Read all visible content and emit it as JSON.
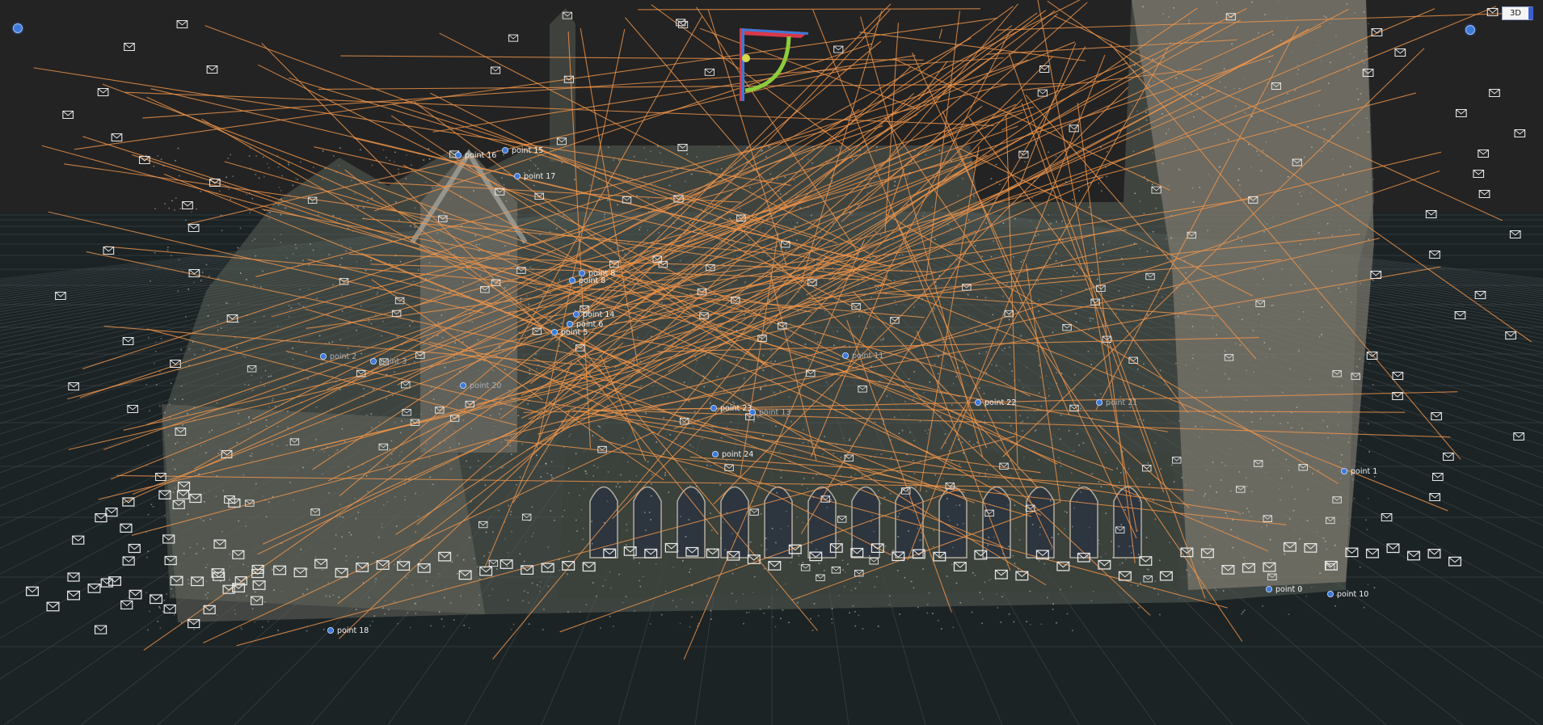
{
  "viewport": {
    "view_mode_label": "3D",
    "background_color": "#232323",
    "ground_color": "#1c2325",
    "grid_color": "#4a5558",
    "ray_color": "#f0954a",
    "camera_color": "#e8e8e8",
    "marker_color": "#3c7ad8"
  },
  "logo": {
    "name": "app-logo-icon",
    "colors": [
      "#3c7ad8",
      "#d8394a",
      "#8ccd3c"
    ]
  },
  "tie_points": [
    {
      "label": "point 15"
    },
    {
      "label": "point 16"
    },
    {
      "label": "point 17"
    },
    {
      "label": "point 8"
    },
    {
      "label": "point 8"
    },
    {
      "label": "point 14"
    },
    {
      "label": "point 6"
    },
    {
      "label": "point 5"
    },
    {
      "label": "point 2"
    },
    {
      "label": "point 3"
    },
    {
      "label": "point 20"
    },
    {
      "label": "point 23"
    },
    {
      "label": "point 11"
    },
    {
      "label": "point 13"
    },
    {
      "label": "point 22"
    },
    {
      "label": "point 21"
    },
    {
      "label": "point 24"
    },
    {
      "label": "point 1"
    },
    {
      "label": "point 0"
    },
    {
      "label": "point 10"
    },
    {
      "label": "point 18"
    }
  ]
}
